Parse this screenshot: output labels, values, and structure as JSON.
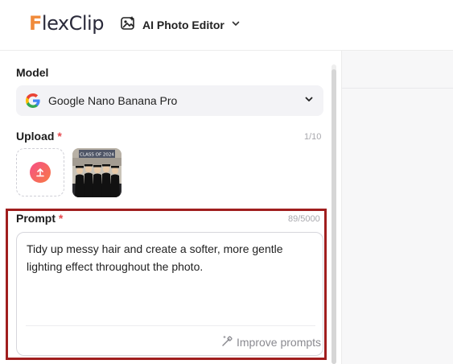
{
  "header": {
    "logo_first": "F",
    "logo_rest": "lexClip",
    "editor_label": "AI Photo Editor"
  },
  "model": {
    "label": "Model",
    "selected": "Google Nano Banana Pro"
  },
  "upload": {
    "label": "Upload",
    "required_mark": "*",
    "count": "1/10",
    "thumbnail_caption": "CLASS OF 2024"
  },
  "prompt": {
    "label": "Prompt",
    "required_mark": "*",
    "count": "89/5000",
    "value": "Tidy up messy hair and create a softer, more gentle lighting effect throughout the photo.",
    "improve_label": "Improve prompts"
  },
  "colors": {
    "accent_orange": "#f08a3a",
    "required_red": "#e5484d",
    "highlight_border": "#a01e1e"
  }
}
